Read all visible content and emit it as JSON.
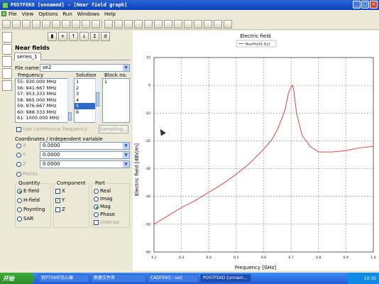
{
  "window": {
    "title": "POSTFEKO [unnamed] - [Near field graph]"
  },
  "menu": [
    "File",
    "View",
    "Options",
    "Run",
    "Windows",
    "Help"
  ],
  "panel": {
    "title": "Near fields",
    "tab": "series_1",
    "file_name_label": "File name",
    "file_name_value": "se2",
    "frequency_header": "Frequency",
    "solution_header": "Solution",
    "block_header": "Block no.",
    "frequencies": [
      "55: 930.000 MHz",
      "56: 941.667 MHz",
      "57: 953.333 MHz",
      "58: 965.000 MHz",
      "59: 976.667 MHz",
      "60: 988.333 MHz",
      "61: 1000.000 MHz"
    ],
    "solutions": [
      "1",
      "2",
      "3",
      "4",
      "5",
      "6"
    ],
    "selected_solution": "5",
    "blocks": [
      "1"
    ],
    "continuous_label": "Use continuous frequency",
    "sampling_button": "Sampling...",
    "coords_title": "Coordinates / Independent variable",
    "coords": [
      {
        "axis": "X",
        "value": "0.0000"
      },
      {
        "axis": "Y",
        "value": "0.0000"
      },
      {
        "axis": "Z",
        "value": "0.0000"
      }
    ],
    "points_label": "Points",
    "quantity_title": "Quantity",
    "quantities": [
      "E-field",
      "H-field",
      "Poynting",
      "SAR"
    ],
    "quantity_selected": "E-field",
    "component_title": "Component",
    "components": [
      "X",
      "Y",
      "Z"
    ],
    "component_checked": "Y",
    "part_title": "Part",
    "parts": [
      "Real",
      "Imag",
      "Mag",
      "Phase"
    ],
    "part_selected": "Mag",
    "unwrap_label": "Unwrap"
  },
  "chart_data": {
    "type": "line",
    "title": "Electric field",
    "xlabel": "Frequency [GHz]",
    "ylabel": "Electric field [dBV/m]",
    "xlim": [
      0.2,
      1.0
    ],
    "ylim": [
      -60,
      10
    ],
    "xticks": [
      "0.2",
      "0.3",
      "0.4",
      "0.5",
      "0.6",
      "0.7",
      "0.8",
      "0.9",
      "1.0"
    ],
    "yticks": [
      "10",
      "0",
      "-10",
      "-20",
      "-30",
      "-40",
      "-50",
      "-60"
    ],
    "grid": true,
    "legend_position": "top-center",
    "series": [
      {
        "name": "NearField1 (Ey)",
        "color": "#e03030",
        "x": [
          0.2,
          0.25,
          0.3,
          0.35,
          0.4,
          0.45,
          0.5,
          0.55,
          0.6,
          0.63,
          0.65,
          0.67,
          0.68,
          0.69,
          0.7,
          0.705,
          0.71,
          0.72,
          0.74,
          0.77,
          0.8,
          0.85,
          0.9,
          0.95,
          1.0
        ],
        "y": [
          -50,
          -47,
          -44,
          -41.5,
          -38.5,
          -35.5,
          -32,
          -28,
          -23,
          -19.5,
          -16,
          -11,
          -8,
          -3,
          -0.5,
          0,
          -2,
          -10,
          -18,
          -22,
          -24,
          -24,
          -23.5,
          -22.5,
          -22
        ]
      }
    ]
  },
  "taskbar": {
    "start": "开始",
    "tasks": [
      "百PT06中怎么编",
      "新建文件夹",
      "CADFEKO - se2",
      "POSTFEKO [unnam..."
    ],
    "clock": "10:35"
  }
}
